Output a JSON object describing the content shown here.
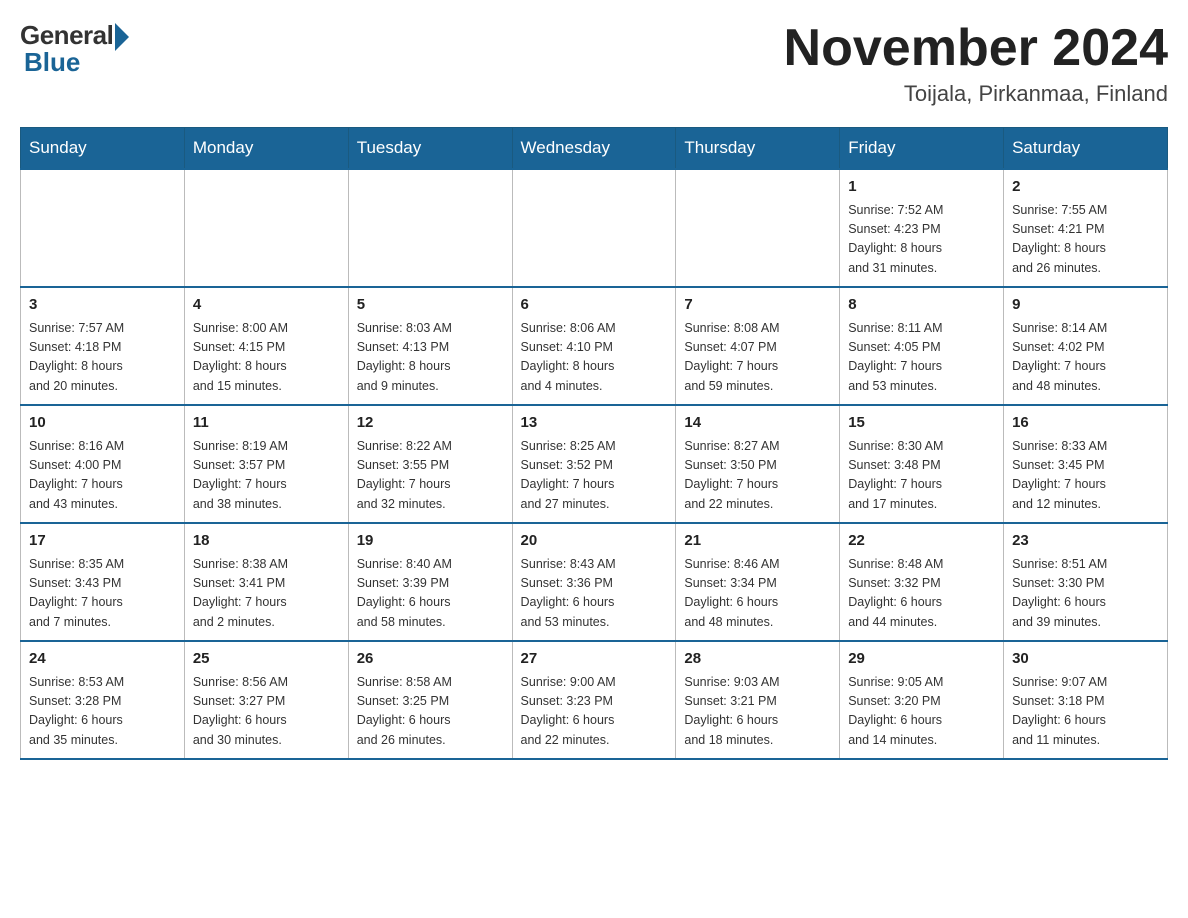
{
  "header": {
    "logo_general": "General",
    "logo_blue": "Blue",
    "month_title": "November 2024",
    "location": "Toijala, Pirkanmaa, Finland"
  },
  "weekdays": [
    "Sunday",
    "Monday",
    "Tuesday",
    "Wednesday",
    "Thursday",
    "Friday",
    "Saturday"
  ],
  "weeks": [
    {
      "days": [
        {
          "number": "",
          "info": ""
        },
        {
          "number": "",
          "info": ""
        },
        {
          "number": "",
          "info": ""
        },
        {
          "number": "",
          "info": ""
        },
        {
          "number": "",
          "info": ""
        },
        {
          "number": "1",
          "info": "Sunrise: 7:52 AM\nSunset: 4:23 PM\nDaylight: 8 hours\nand 31 minutes."
        },
        {
          "number": "2",
          "info": "Sunrise: 7:55 AM\nSunset: 4:21 PM\nDaylight: 8 hours\nand 26 minutes."
        }
      ]
    },
    {
      "days": [
        {
          "number": "3",
          "info": "Sunrise: 7:57 AM\nSunset: 4:18 PM\nDaylight: 8 hours\nand 20 minutes."
        },
        {
          "number": "4",
          "info": "Sunrise: 8:00 AM\nSunset: 4:15 PM\nDaylight: 8 hours\nand 15 minutes."
        },
        {
          "number": "5",
          "info": "Sunrise: 8:03 AM\nSunset: 4:13 PM\nDaylight: 8 hours\nand 9 minutes."
        },
        {
          "number": "6",
          "info": "Sunrise: 8:06 AM\nSunset: 4:10 PM\nDaylight: 8 hours\nand 4 minutes."
        },
        {
          "number": "7",
          "info": "Sunrise: 8:08 AM\nSunset: 4:07 PM\nDaylight: 7 hours\nand 59 minutes."
        },
        {
          "number": "8",
          "info": "Sunrise: 8:11 AM\nSunset: 4:05 PM\nDaylight: 7 hours\nand 53 minutes."
        },
        {
          "number": "9",
          "info": "Sunrise: 8:14 AM\nSunset: 4:02 PM\nDaylight: 7 hours\nand 48 minutes."
        }
      ]
    },
    {
      "days": [
        {
          "number": "10",
          "info": "Sunrise: 8:16 AM\nSunset: 4:00 PM\nDaylight: 7 hours\nand 43 minutes."
        },
        {
          "number": "11",
          "info": "Sunrise: 8:19 AM\nSunset: 3:57 PM\nDaylight: 7 hours\nand 38 minutes."
        },
        {
          "number": "12",
          "info": "Sunrise: 8:22 AM\nSunset: 3:55 PM\nDaylight: 7 hours\nand 32 minutes."
        },
        {
          "number": "13",
          "info": "Sunrise: 8:25 AM\nSunset: 3:52 PM\nDaylight: 7 hours\nand 27 minutes."
        },
        {
          "number": "14",
          "info": "Sunrise: 8:27 AM\nSunset: 3:50 PM\nDaylight: 7 hours\nand 22 minutes."
        },
        {
          "number": "15",
          "info": "Sunrise: 8:30 AM\nSunset: 3:48 PM\nDaylight: 7 hours\nand 17 minutes."
        },
        {
          "number": "16",
          "info": "Sunrise: 8:33 AM\nSunset: 3:45 PM\nDaylight: 7 hours\nand 12 minutes."
        }
      ]
    },
    {
      "days": [
        {
          "number": "17",
          "info": "Sunrise: 8:35 AM\nSunset: 3:43 PM\nDaylight: 7 hours\nand 7 minutes."
        },
        {
          "number": "18",
          "info": "Sunrise: 8:38 AM\nSunset: 3:41 PM\nDaylight: 7 hours\nand 2 minutes."
        },
        {
          "number": "19",
          "info": "Sunrise: 8:40 AM\nSunset: 3:39 PM\nDaylight: 6 hours\nand 58 minutes."
        },
        {
          "number": "20",
          "info": "Sunrise: 8:43 AM\nSunset: 3:36 PM\nDaylight: 6 hours\nand 53 minutes."
        },
        {
          "number": "21",
          "info": "Sunrise: 8:46 AM\nSunset: 3:34 PM\nDaylight: 6 hours\nand 48 minutes."
        },
        {
          "number": "22",
          "info": "Sunrise: 8:48 AM\nSunset: 3:32 PM\nDaylight: 6 hours\nand 44 minutes."
        },
        {
          "number": "23",
          "info": "Sunrise: 8:51 AM\nSunset: 3:30 PM\nDaylight: 6 hours\nand 39 minutes."
        }
      ]
    },
    {
      "days": [
        {
          "number": "24",
          "info": "Sunrise: 8:53 AM\nSunset: 3:28 PM\nDaylight: 6 hours\nand 35 minutes."
        },
        {
          "number": "25",
          "info": "Sunrise: 8:56 AM\nSunset: 3:27 PM\nDaylight: 6 hours\nand 30 minutes."
        },
        {
          "number": "26",
          "info": "Sunrise: 8:58 AM\nSunset: 3:25 PM\nDaylight: 6 hours\nand 26 minutes."
        },
        {
          "number": "27",
          "info": "Sunrise: 9:00 AM\nSunset: 3:23 PM\nDaylight: 6 hours\nand 22 minutes."
        },
        {
          "number": "28",
          "info": "Sunrise: 9:03 AM\nSunset: 3:21 PM\nDaylight: 6 hours\nand 18 minutes."
        },
        {
          "number": "29",
          "info": "Sunrise: 9:05 AM\nSunset: 3:20 PM\nDaylight: 6 hours\nand 14 minutes."
        },
        {
          "number": "30",
          "info": "Sunrise: 9:07 AM\nSunset: 3:18 PM\nDaylight: 6 hours\nand 11 minutes."
        }
      ]
    }
  ]
}
